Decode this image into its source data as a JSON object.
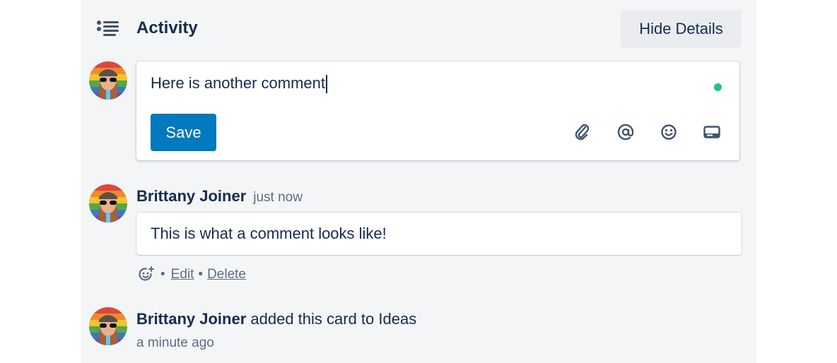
{
  "section": {
    "icon": "activity-list-icon",
    "title": "Activity",
    "hide_details_label": "Hide Details"
  },
  "editor": {
    "avatar": "user-avatar",
    "value": "Here is another comment",
    "status_color": "#1fc08e",
    "save_label": "Save",
    "tools": [
      {
        "name": "attachment-icon"
      },
      {
        "name": "mention-icon"
      },
      {
        "name": "emoji-icon"
      },
      {
        "name": "card-icon"
      }
    ]
  },
  "comment": {
    "author": "Brittany Joiner",
    "time": "just now",
    "text": "This is what a comment looks like!",
    "actions": {
      "reaction_icon": "add-reaction-icon",
      "separator": "•",
      "edit_label": "Edit",
      "delete_label": "Delete"
    }
  },
  "activity": {
    "author": "Brittany Joiner",
    "action": "added this card to Ideas",
    "time": "a minute ago"
  },
  "colors": {
    "primary": "#0079bf",
    "text": "#172b4d",
    "subtle": "#5e6c84",
    "panel": "#f4f5f7"
  }
}
